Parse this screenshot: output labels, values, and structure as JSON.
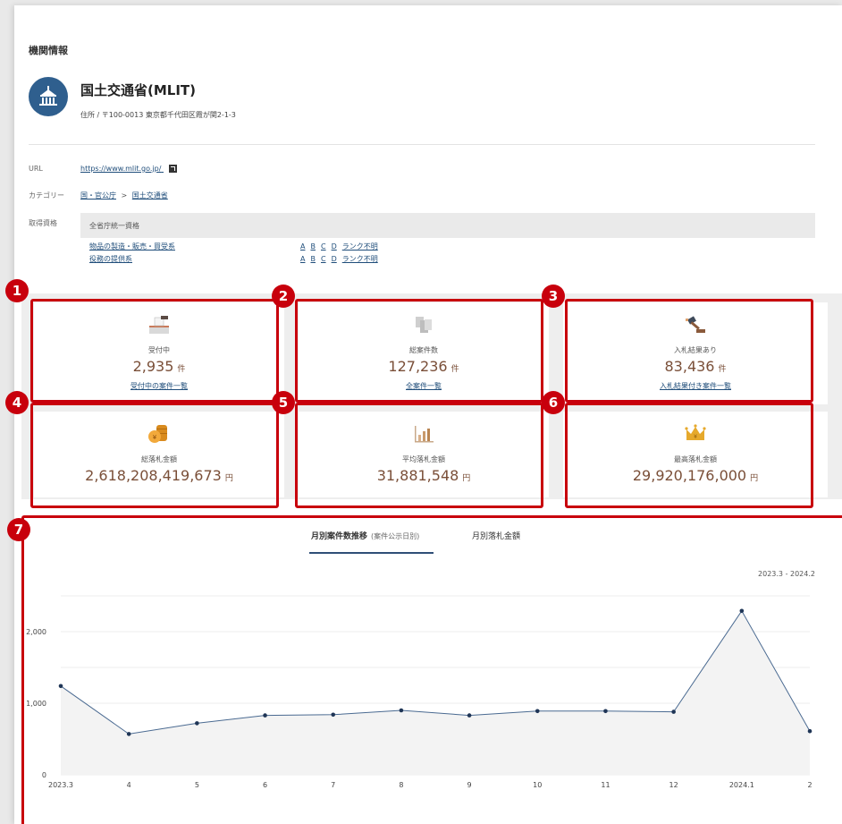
{
  "section_title": "機関情報",
  "org": {
    "name": "国土交通省(MLIT)",
    "address": "住所 / 〒100-0013 東京都千代田区霞が関2-1-3"
  },
  "info": {
    "url_label": "URL",
    "url": "https://www.mlit.go.jp/",
    "category_label": "カテゴリー",
    "category_parent": "国・官公庁",
    "category_sep": ">",
    "category_child": "国土交通省",
    "qual_label": "取得資格",
    "qual_header": "全省庁統一資格",
    "qual_rows": [
      {
        "name": "物品の製造・販売・買受系",
        "ranks": [
          "A",
          "B",
          "C",
          "D",
          "ランク不明"
        ]
      },
      {
        "name": "役務の提供系",
        "ranks": [
          "A",
          "B",
          "C",
          "D",
          "ランク不明"
        ]
      }
    ]
  },
  "stats": [
    {
      "label": "受付中",
      "value": "2,935",
      "unit": "件",
      "link": "受付中の案件一覧",
      "icon": "ballot-box-icon"
    },
    {
      "label": "総案件数",
      "value": "127,236",
      "unit": "件",
      "link": "全案件一覧",
      "icon": "documents-icon"
    },
    {
      "label": "入札結果あり",
      "value": "83,436",
      "unit": "件",
      "link": "入札結果付き案件一覧",
      "icon": "gavel-icon"
    },
    {
      "label": "総落札金額",
      "value": "2,618,208,419,673",
      "unit": "円",
      "icon": "coins-icon"
    },
    {
      "label": "平均落札金額",
      "value": "31,881,548",
      "unit": "円",
      "icon": "bar-chart-icon"
    },
    {
      "label": "最高落札金額",
      "value": "29,920,176,000",
      "unit": "円",
      "icon": "crown-icon"
    }
  ],
  "badges": [
    "1",
    "2",
    "3",
    "4",
    "5",
    "6",
    "7"
  ],
  "tabs": {
    "active_label": "月別案件数推移",
    "active_note": "(案件公示日別)",
    "other_label": "月別落札金額"
  },
  "period": "2023.3 - 2024.2",
  "colors": {
    "accent": "#c8000c",
    "link": "#1f4d7a",
    "value": "#7a4f38",
    "line": "#4a6a91"
  },
  "chart_data": {
    "type": "area",
    "categories": [
      "2023.3",
      "4",
      "5",
      "6",
      "7",
      "8",
      "9",
      "10",
      "11",
      "12",
      "2024.1",
      "2"
    ],
    "values": [
      1240,
      570,
      720,
      830,
      840,
      900,
      830,
      890,
      890,
      880,
      2290,
      610
    ],
    "ylim": [
      0,
      2500
    ],
    "yticks": [
      "0",
      "1,000",
      "2,000"
    ],
    "ytick_values": [
      0,
      1000,
      2000
    ],
    "grid": true
  }
}
